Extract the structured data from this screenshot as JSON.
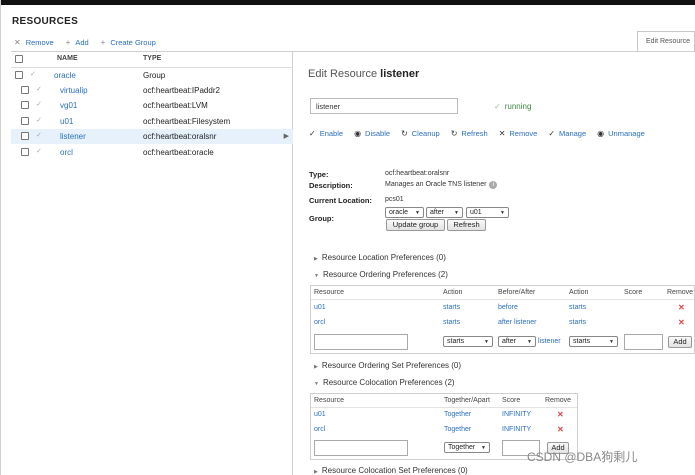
{
  "header": {
    "title": "RESOURCES",
    "actions": {
      "remove": "Remove",
      "add": "Add",
      "create_group": "Create Group"
    },
    "tab": "Edit Resource"
  },
  "table": {
    "col_name": "NAME",
    "col_type": "TYPE",
    "rows": [
      {
        "name": "oracle",
        "type": "Group"
      },
      {
        "name": "virtualip",
        "type": "ocf:heartbeat:IPaddr2"
      },
      {
        "name": "vg01",
        "type": "ocf:heartbeat:LVM"
      },
      {
        "name": "u01",
        "type": "ocf:heartbeat:Filesystem"
      },
      {
        "name": "listener",
        "type": "ocf:heartbeat:oralsnr",
        "selected": true
      },
      {
        "name": "orcl",
        "type": "ocf:heartbeat:oracle"
      }
    ]
  },
  "edit": {
    "title_prefix": "Edit Resource",
    "title_name": "listener",
    "name_value": "listener",
    "status": "running",
    "ops": [
      "Enable",
      "Disable",
      "Cleanup",
      "Refresh",
      "Remove",
      "Manage",
      "Unmanage"
    ],
    "type_label": "Type:",
    "type_value": "ocf:heartbeat:oralsnr",
    "desc_label": "Description:",
    "desc_value": "Manages an Oracle TNS listener",
    "loc_label": "Current Location:",
    "loc_value": "pcs01",
    "group_label": "Group:",
    "group_select": "oracle",
    "position_select": "after",
    "member_select": "u01",
    "update_group": "Update group",
    "refresh": "Refresh"
  },
  "sections": {
    "location": "Resource Location Preferences (0)",
    "ordering": "Resource Ordering Preferences (2)",
    "ordering_set": "Resource Ordering Set Preferences (0)",
    "colocation": "Resource Colocation Preferences (2)",
    "colocation_set": "Resource Colocation Set Preferences (0)"
  },
  "ordering_table": {
    "headers": [
      "Resource",
      "Action",
      "Before/After",
      "Action",
      "Score",
      "Remove"
    ],
    "rows": [
      {
        "resource": "u01",
        "action": "starts",
        "ba": "before",
        "action2": "starts"
      },
      {
        "resource": "orcl",
        "action": "starts",
        "ba": "after listener",
        "action2": "starts"
      }
    ],
    "new_action": "starts",
    "new_ba": "after",
    "new_label": "listener",
    "new_action2": "starts",
    "add": "Add"
  },
  "colocation_table": {
    "headers": [
      "Resource",
      "Together/Apart",
      "Score",
      "Remove"
    ],
    "rows": [
      {
        "resource": "u01",
        "together": "Together",
        "score": "INFINITY"
      },
      {
        "resource": "orcl",
        "together": "Together",
        "score": "INFINITY"
      }
    ],
    "new_together": "Together",
    "add": "Add"
  },
  "watermark": "CSDN @DBA狗剩儿"
}
